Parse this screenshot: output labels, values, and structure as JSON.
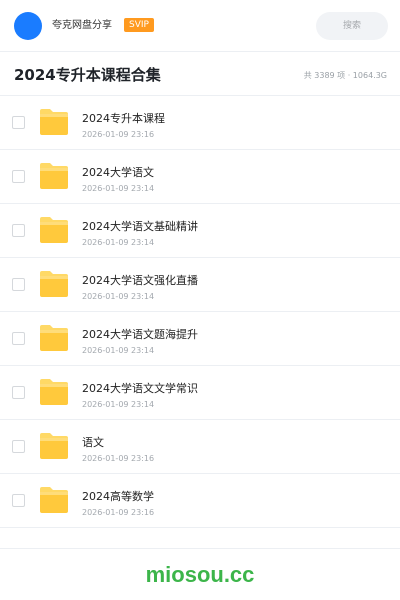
{
  "header": {
    "brand_name": "夸克网盘分享",
    "badge": "SVIP",
    "search_placeholder": "搜索"
  },
  "title_row": {
    "title": "2024专升本课程合集",
    "meta": "共 3389 项 · 1064.3G"
  },
  "files": [
    {
      "name": "2024专升本课程",
      "date": "2026-01-09 23:16"
    },
    {
      "name": "2024大学语文",
      "date": "2026-01-09 23:14"
    },
    {
      "name": "2024大学语文基础精讲",
      "date": "2026-01-09 23:14"
    },
    {
      "name": "2024大学语文强化直播",
      "date": "2026-01-09 23:14"
    },
    {
      "name": "2024大学语文题海提升",
      "date": "2026-01-09 23:14"
    },
    {
      "name": "2024大学语文文学常识",
      "date": "2026-01-09 23:14"
    },
    {
      "name": "语文",
      "date": "2026-01-09 23:16"
    },
    {
      "name": "2024高等数学",
      "date": "2026-01-09 23:16"
    }
  ],
  "icons": {
    "folder": "folder-icon",
    "checkbox": "checkbox"
  },
  "colors": {
    "accent": "#1a7cff",
    "badge": "#ff9a1f",
    "folder": "#ffc93c",
    "watermark": "#3cb54a"
  },
  "footer": {
    "watermark": "miosou.cc"
  }
}
